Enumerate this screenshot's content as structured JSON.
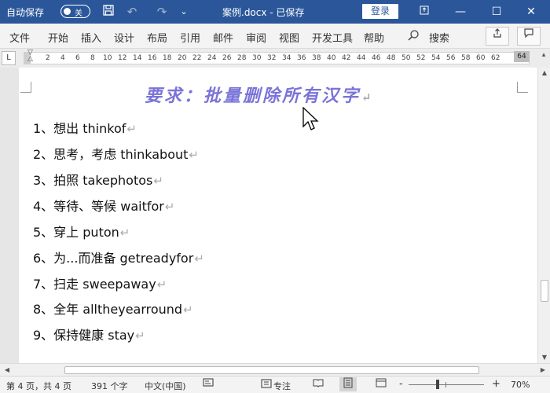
{
  "titlebar": {
    "autosave_label": "自动保存",
    "autosave_state": "关",
    "doc_title": "案例.docx - 已保存",
    "login_label": "登录",
    "icons": [
      "save-icon",
      "undo-icon",
      "redo-icon",
      "customize-quick-access-icon"
    ],
    "window_icons": [
      "ribbon-display-icon",
      "minimize-icon",
      "maximize-icon",
      "close-icon"
    ]
  },
  "menu": {
    "items": [
      "文件",
      "开始",
      "插入",
      "设计",
      "布局",
      "引用",
      "邮件",
      "审阅",
      "视图",
      "开发工具",
      "帮助"
    ],
    "search_label": "搜索",
    "share_icon": "share-icon",
    "comment_icon": "comment-icon"
  },
  "ruler": {
    "tab_selector": "L",
    "ticks": [
      "2",
      "4",
      "6",
      "8",
      "10",
      "12",
      "14",
      "16",
      "18",
      "20",
      "22",
      "24",
      "26",
      "28",
      "30",
      "32",
      "34",
      "36",
      "38",
      "40",
      "42",
      "44",
      "46",
      "48",
      "50",
      "52",
      "54",
      "56",
      "58",
      "60",
      "62"
    ],
    "right_marker": "64"
  },
  "document": {
    "heading": "要求：批量删除所有汉字",
    "paragraph_mark": "↵",
    "items": [
      "1、想出 thinkof",
      "2、思考，考虑 thinkabout",
      "3、拍照 takephotos",
      "4、等待、等候 waitfor",
      "5、穿上 puton",
      "6、为...而准备 getreadyfor",
      "7、扫走 sweepaway",
      "8、全年 alltheyearround",
      "9、保持健康 stay"
    ]
  },
  "statusbar": {
    "page_info": "第 4 页，共 4 页",
    "word_count": "391 个字",
    "language": "中文(中国)",
    "focus_label": "专注",
    "zoom_minus": "-",
    "zoom_plus": "+",
    "zoom_level": "70%"
  },
  "colors": {
    "titlebar_bg": "#2b579a",
    "heading_color": "#7a74d8"
  }
}
